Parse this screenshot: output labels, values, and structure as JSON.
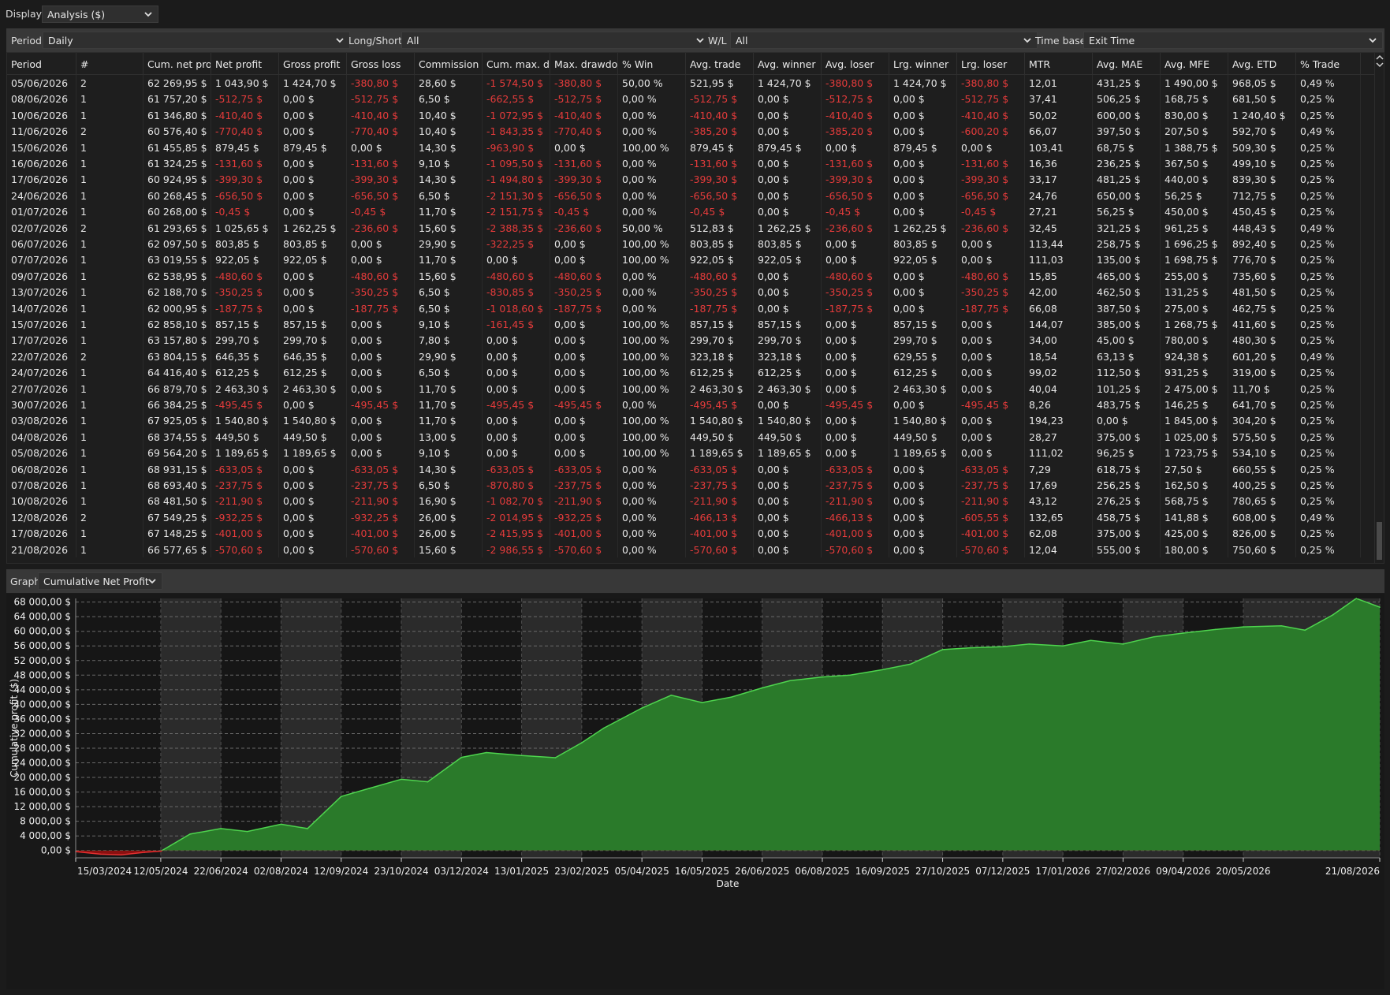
{
  "topbar": {
    "display_label": "Display",
    "display_value": "Analysis ($)"
  },
  "filters": {
    "period_label": "Period",
    "period_value": "Daily",
    "longshort_label": "Long/Short",
    "longshort_value": "All",
    "wl_label": "W/L",
    "wl_value": "All",
    "timebase_label": "Time base",
    "timebase_value": "Exit Time"
  },
  "table": {
    "columns": [
      "Period",
      "#",
      "Cum. net profi",
      "Net profit",
      "Gross profit",
      "Gross loss",
      "Commission",
      "Cum. max. dra",
      "Max. drawdow",
      "% Win",
      "Avg. trade",
      "Avg. winner",
      "Avg. loser",
      "Lrg. winner",
      "Lrg. loser",
      "MTR",
      "Avg. MAE",
      "Avg. MFE",
      "Avg. ETD",
      "% Trade"
    ],
    "rows": [
      [
        "05/06/2026",
        "2",
        "62 269,95 $",
        "1 043,90 $",
        "1 424,70 $",
        "-380,80 $",
        "28,60 $",
        "-1 574,50 $",
        "-380,80 $",
        "50,00 %",
        "521,95 $",
        "1 424,70 $",
        "-380,80 $",
        "1 424,70 $",
        "-380,80 $",
        "12,01",
        "431,25 $",
        "1 490,00 $",
        "968,05 $",
        "0,49 %"
      ],
      [
        "08/06/2026",
        "1",
        "61 757,20 $",
        "-512,75 $",
        "0,00 $",
        "-512,75 $",
        "6,50 $",
        "-662,55 $",
        "-512,75 $",
        "0,00 %",
        "-512,75 $",
        "0,00 $",
        "-512,75 $",
        "0,00 $",
        "-512,75 $",
        "37,41",
        "506,25 $",
        "168,75 $",
        "681,50 $",
        "0,25 %"
      ],
      [
        "10/06/2026",
        "1",
        "61 346,80 $",
        "-410,40 $",
        "0,00 $",
        "-410,40 $",
        "10,40 $",
        "-1 072,95 $",
        "-410,40 $",
        "0,00 %",
        "-410,40 $",
        "0,00 $",
        "-410,40 $",
        "0,00 $",
        "-410,40 $",
        "50,02",
        "600,00 $",
        "830,00 $",
        "1 240,40 $",
        "0,25 %"
      ],
      [
        "11/06/2026",
        "2",
        "60 576,40 $",
        "-770,40 $",
        "0,00 $",
        "-770,40 $",
        "10,40 $",
        "-1 843,35 $",
        "-770,40 $",
        "0,00 %",
        "-385,20 $",
        "0,00 $",
        "-385,20 $",
        "0,00 $",
        "-600,20 $",
        "66,07",
        "397,50 $",
        "207,50 $",
        "592,70 $",
        "0,49 %"
      ],
      [
        "15/06/2026",
        "1",
        "61 455,85 $",
        "879,45 $",
        "879,45 $",
        "0,00 $",
        "14,30 $",
        "-963,90 $",
        "0,00 $",
        "100,00 %",
        "879,45 $",
        "879,45 $",
        "0,00 $",
        "879,45 $",
        "0,00 $",
        "103,41",
        "68,75 $",
        "1 388,75 $",
        "509,30 $",
        "0,25 %"
      ],
      [
        "16/06/2026",
        "1",
        "61 324,25 $",
        "-131,60 $",
        "0,00 $",
        "-131,60 $",
        "9,10 $",
        "-1 095,50 $",
        "-131,60 $",
        "0,00 %",
        "-131,60 $",
        "0,00 $",
        "-131,60 $",
        "0,00 $",
        "-131,60 $",
        "16,36",
        "236,25 $",
        "367,50 $",
        "499,10 $",
        "0,25 %"
      ],
      [
        "17/06/2026",
        "1",
        "60 924,95 $",
        "-399,30 $",
        "0,00 $",
        "-399,30 $",
        "14,30 $",
        "-1 494,80 $",
        "-399,30 $",
        "0,00 %",
        "-399,30 $",
        "0,00 $",
        "-399,30 $",
        "0,00 $",
        "-399,30 $",
        "33,17",
        "481,25 $",
        "440,00 $",
        "839,30 $",
        "0,25 %"
      ],
      [
        "24/06/2026",
        "1",
        "60 268,45 $",
        "-656,50 $",
        "0,00 $",
        "-656,50 $",
        "6,50 $",
        "-2 151,30 $",
        "-656,50 $",
        "0,00 %",
        "-656,50 $",
        "0,00 $",
        "-656,50 $",
        "0,00 $",
        "-656,50 $",
        "24,76",
        "650,00 $",
        "56,25 $",
        "712,75 $",
        "0,25 %"
      ],
      [
        "01/07/2026",
        "1",
        "60 268,00 $",
        "-0,45 $",
        "0,00 $",
        "-0,45 $",
        "11,70 $",
        "-2 151,75 $",
        "-0,45 $",
        "0,00 %",
        "-0,45 $",
        "0,00 $",
        "-0,45 $",
        "0,00 $",
        "-0,45 $",
        "27,21",
        "56,25 $",
        "450,00 $",
        "450,45 $",
        "0,25 %"
      ],
      [
        "02/07/2026",
        "2",
        "61 293,65 $",
        "1 025,65 $",
        "1 262,25 $",
        "-236,60 $",
        "15,60 $",
        "-2 388,35 $",
        "-236,60 $",
        "50,00 %",
        "512,83 $",
        "1 262,25 $",
        "-236,60 $",
        "1 262,25 $",
        "-236,60 $",
        "32,45",
        "321,25 $",
        "961,25 $",
        "448,43 $",
        "0,49 %"
      ],
      [
        "06/07/2026",
        "1",
        "62 097,50 $",
        "803,85 $",
        "803,85 $",
        "0,00 $",
        "29,90 $",
        "-322,25 $",
        "0,00 $",
        "100,00 %",
        "803,85 $",
        "803,85 $",
        "0,00 $",
        "803,85 $",
        "0,00 $",
        "113,44",
        "258,75 $",
        "1 696,25 $",
        "892,40 $",
        "0,25 %"
      ],
      [
        "07/07/2026",
        "1",
        "63 019,55 $",
        "922,05 $",
        "922,05 $",
        "0,00 $",
        "11,70 $",
        "0,00 $",
        "0,00 $",
        "100,00 %",
        "922,05 $",
        "922,05 $",
        "0,00 $",
        "922,05 $",
        "0,00 $",
        "111,03",
        "135,00 $",
        "1 698,75 $",
        "776,70 $",
        "0,25 %"
      ],
      [
        "09/07/2026",
        "1",
        "62 538,95 $",
        "-480,60 $",
        "0,00 $",
        "-480,60 $",
        "15,60 $",
        "-480,60 $",
        "-480,60 $",
        "0,00 %",
        "-480,60 $",
        "0,00 $",
        "-480,60 $",
        "0,00 $",
        "-480,60 $",
        "15,85",
        "465,00 $",
        "255,00 $",
        "735,60 $",
        "0,25 %"
      ],
      [
        "13/07/2026",
        "1",
        "62 188,70 $",
        "-350,25 $",
        "0,00 $",
        "-350,25 $",
        "6,50 $",
        "-830,85 $",
        "-350,25 $",
        "0,00 %",
        "-350,25 $",
        "0,00 $",
        "-350,25 $",
        "0,00 $",
        "-350,25 $",
        "42,00",
        "462,50 $",
        "131,25 $",
        "481,50 $",
        "0,25 %"
      ],
      [
        "14/07/2026",
        "1",
        "62 000,95 $",
        "-187,75 $",
        "0,00 $",
        "-187,75 $",
        "6,50 $",
        "-1 018,60 $",
        "-187,75 $",
        "0,00 %",
        "-187,75 $",
        "0,00 $",
        "-187,75 $",
        "0,00 $",
        "-187,75 $",
        "66,08",
        "387,50 $",
        "275,00 $",
        "462,75 $",
        "0,25 %"
      ],
      [
        "15/07/2026",
        "1",
        "62 858,10 $",
        "857,15 $",
        "857,15 $",
        "0,00 $",
        "9,10 $",
        "-161,45 $",
        "0,00 $",
        "100,00 %",
        "857,15 $",
        "857,15 $",
        "0,00 $",
        "857,15 $",
        "0,00 $",
        "144,07",
        "385,00 $",
        "1 268,75 $",
        "411,60 $",
        "0,25 %"
      ],
      [
        "17/07/2026",
        "1",
        "63 157,80 $",
        "299,70 $",
        "299,70 $",
        "0,00 $",
        "7,80 $",
        "0,00 $",
        "0,00 $",
        "100,00 %",
        "299,70 $",
        "299,70 $",
        "0,00 $",
        "299,70 $",
        "0,00 $",
        "34,00",
        "45,00 $",
        "780,00 $",
        "480,30 $",
        "0,25 %"
      ],
      [
        "22/07/2026",
        "2",
        "63 804,15 $",
        "646,35 $",
        "646,35 $",
        "0,00 $",
        "29,90 $",
        "0,00 $",
        "0,00 $",
        "100,00 %",
        "323,18 $",
        "323,18 $",
        "0,00 $",
        "629,55 $",
        "0,00 $",
        "18,54",
        "63,13 $",
        "924,38 $",
        "601,20 $",
        "0,49 %"
      ],
      [
        "24/07/2026",
        "1",
        "64 416,40 $",
        "612,25 $",
        "612,25 $",
        "0,00 $",
        "6,50 $",
        "0,00 $",
        "0,00 $",
        "100,00 %",
        "612,25 $",
        "612,25 $",
        "0,00 $",
        "612,25 $",
        "0,00 $",
        "99,02",
        "112,50 $",
        "931,25 $",
        "319,00 $",
        "0,25 %"
      ],
      [
        "27/07/2026",
        "1",
        "66 879,70 $",
        "2 463,30 $",
        "2 463,30 $",
        "0,00 $",
        "11,70 $",
        "0,00 $",
        "0,00 $",
        "100,00 %",
        "2 463,30 $",
        "2 463,30 $",
        "0,00 $",
        "2 463,30 $",
        "0,00 $",
        "40,04",
        "101,25 $",
        "2 475,00 $",
        "11,70 $",
        "0,25 %"
      ],
      [
        "30/07/2026",
        "1",
        "66 384,25 $",
        "-495,45 $",
        "0,00 $",
        "-495,45 $",
        "11,70 $",
        "-495,45 $",
        "-495,45 $",
        "0,00 %",
        "-495,45 $",
        "0,00 $",
        "-495,45 $",
        "0,00 $",
        "-495,45 $",
        "8,26",
        "483,75 $",
        "146,25 $",
        "641,70 $",
        "0,25 %"
      ],
      [
        "03/08/2026",
        "1",
        "67 925,05 $",
        "1 540,80 $",
        "1 540,80 $",
        "0,00 $",
        "11,70 $",
        "0,00 $",
        "0,00 $",
        "100,00 %",
        "1 540,80 $",
        "1 540,80 $",
        "0,00 $",
        "1 540,80 $",
        "0,00 $",
        "194,23",
        "0,00 $",
        "1 845,00 $",
        "304,20 $",
        "0,25 %"
      ],
      [
        "04/08/2026",
        "1",
        "68 374,55 $",
        "449,50 $",
        "449,50 $",
        "0,00 $",
        "13,00 $",
        "0,00 $",
        "0,00 $",
        "100,00 %",
        "449,50 $",
        "449,50 $",
        "0,00 $",
        "449,50 $",
        "0,00 $",
        "28,27",
        "375,00 $",
        "1 025,00 $",
        "575,50 $",
        "0,25 %"
      ],
      [
        "05/08/2026",
        "1",
        "69 564,20 $",
        "1 189,65 $",
        "1 189,65 $",
        "0,00 $",
        "9,10 $",
        "0,00 $",
        "0,00 $",
        "100,00 %",
        "1 189,65 $",
        "1 189,65 $",
        "0,00 $",
        "1 189,65 $",
        "0,00 $",
        "111,02",
        "96,25 $",
        "1 723,75 $",
        "534,10 $",
        "0,25 %"
      ],
      [
        "06/08/2026",
        "1",
        "68 931,15 $",
        "-633,05 $",
        "0,00 $",
        "-633,05 $",
        "14,30 $",
        "-633,05 $",
        "-633,05 $",
        "0,00 %",
        "-633,05 $",
        "0,00 $",
        "-633,05 $",
        "0,00 $",
        "-633,05 $",
        "7,29",
        "618,75 $",
        "27,50 $",
        "660,55 $",
        "0,25 %"
      ],
      [
        "07/08/2026",
        "1",
        "68 693,40 $",
        "-237,75 $",
        "0,00 $",
        "-237,75 $",
        "6,50 $",
        "-870,80 $",
        "-237,75 $",
        "0,00 %",
        "-237,75 $",
        "0,00 $",
        "-237,75 $",
        "0,00 $",
        "-237,75 $",
        "17,69",
        "256,25 $",
        "162,50 $",
        "400,25 $",
        "0,25 %"
      ],
      [
        "10/08/2026",
        "1",
        "68 481,50 $",
        "-211,90 $",
        "0,00 $",
        "-211,90 $",
        "16,90 $",
        "-1 082,70 $",
        "-211,90 $",
        "0,00 %",
        "-211,90 $",
        "0,00 $",
        "-211,90 $",
        "0,00 $",
        "-211,90 $",
        "43,12",
        "276,25 $",
        "568,75 $",
        "780,65 $",
        "0,25 %"
      ],
      [
        "12/08/2026",
        "2",
        "67 549,25 $",
        "-932,25 $",
        "0,00 $",
        "-932,25 $",
        "26,00 $",
        "-2 014,95 $",
        "-932,25 $",
        "0,00 %",
        "-466,13 $",
        "0,00 $",
        "-466,13 $",
        "0,00 $",
        "-605,55 $",
        "132,65",
        "458,75 $",
        "141,88 $",
        "608,00 $",
        "0,49 %"
      ],
      [
        "17/08/2026",
        "1",
        "67 148,25 $",
        "-401,00 $",
        "0,00 $",
        "-401,00 $",
        "26,00 $",
        "-2 415,95 $",
        "-401,00 $",
        "0,00 %",
        "-401,00 $",
        "0,00 $",
        "-401,00 $",
        "0,00 $",
        "-401,00 $",
        "62,08",
        "375,00 $",
        "425,00 $",
        "826,00 $",
        "0,25 %"
      ],
      [
        "21/08/2026",
        "1",
        "66 577,65 $",
        "-570,60 $",
        "0,00 $",
        "-570,60 $",
        "15,60 $",
        "-2 986,55 $",
        "-570,60 $",
        "0,00 %",
        "-570,60 $",
        "0,00 $",
        "-570,60 $",
        "0,00 $",
        "-570,60 $",
        "12,04",
        "555,00 $",
        "180,00 $",
        "750,60 $",
        "0,25 %"
      ]
    ]
  },
  "graph": {
    "label": "Graph",
    "value": "Cumulative Net Profit"
  },
  "chart_data": {
    "type": "area",
    "title": "",
    "xlabel": "Date",
    "ylabel": "Cumulative profit ($)",
    "ylim": [
      -2000,
      69000
    ],
    "y_ticks": [
      "0,00 $",
      "4 000,00 $",
      "8 000,00 $",
      "12 000,00 $",
      "16 000,00 $",
      "20 000,00 $",
      "24 000,00 $",
      "28 000,00 $",
      "32 000,00 $",
      "36 000,00 $",
      "40 000,00 $",
      "44 000,00 $",
      "48 000,00 $",
      "52 000,00 $",
      "56 000,00 $",
      "60 000,00 $",
      "64 000,00 $",
      "68 000,00 $"
    ],
    "y_tick_values": [
      0,
      4000,
      8000,
      12000,
      16000,
      20000,
      24000,
      28000,
      32000,
      36000,
      40000,
      44000,
      48000,
      52000,
      56000,
      60000,
      64000,
      68000
    ],
    "x_ticks": [
      "15/03/2024",
      "12/05/2024",
      "22/06/2024",
      "02/08/2024",
      "12/09/2024",
      "23/10/2024",
      "03/12/2024",
      "13/01/2025",
      "23/02/2025",
      "05/04/2025",
      "16/05/2025",
      "26/06/2025",
      "06/08/2025",
      "16/09/2025",
      "27/10/2025",
      "07/12/2025",
      "17/01/2026",
      "27/02/2026",
      "09/04/2026",
      "20/05/2026",
      "21/08/2026"
    ],
    "grid": true,
    "colors": {
      "positive_fill": "#2a7a2a",
      "positive_line": "#4ed44e",
      "negative_fill": "#8a1010",
      "negative_line": "#e33030"
    },
    "x": [
      "15/03/2024",
      "01/04/2024",
      "15/04/2024",
      "01/05/2024",
      "12/05/2024",
      "01/06/2024",
      "22/06/2024",
      "10/07/2024",
      "02/08/2024",
      "20/08/2024",
      "12/09/2024",
      "01/10/2024",
      "23/10/2024",
      "10/11/2024",
      "03/12/2024",
      "20/12/2024",
      "13/01/2025",
      "05/02/2025",
      "23/02/2025",
      "10/03/2025",
      "05/04/2025",
      "25/04/2025",
      "16/05/2025",
      "05/06/2025",
      "26/06/2025",
      "15/07/2025",
      "06/08/2025",
      "25/08/2025",
      "16/09/2025",
      "05/10/2025",
      "27/10/2025",
      "15/11/2025",
      "07/12/2025",
      "25/12/2025",
      "17/01/2026",
      "05/02/2026",
      "27/02/2026",
      "20/03/2026",
      "09/04/2026",
      "01/05/2026",
      "20/05/2026",
      "15/06/2026",
      "01/07/2026",
      "20/07/2026",
      "05/08/2026",
      "21/08/2026"
    ],
    "values": [
      -300,
      -1000,
      -1200,
      -500,
      -200,
      4500,
      6000,
      5200,
      7200,
      6000,
      14800,
      17000,
      19500,
      18800,
      25500,
      26800,
      26000,
      25400,
      29500,
      33500,
      39000,
      42500,
      40500,
      42000,
      44500,
      46500,
      47500,
      48000,
      49500,
      51000,
      55000,
      55500,
      55800,
      56500,
      56000,
      57500,
      56500,
      58500,
      59500,
      60500,
      61200,
      61500,
      60300,
      64500,
      69000,
      66600
    ]
  }
}
